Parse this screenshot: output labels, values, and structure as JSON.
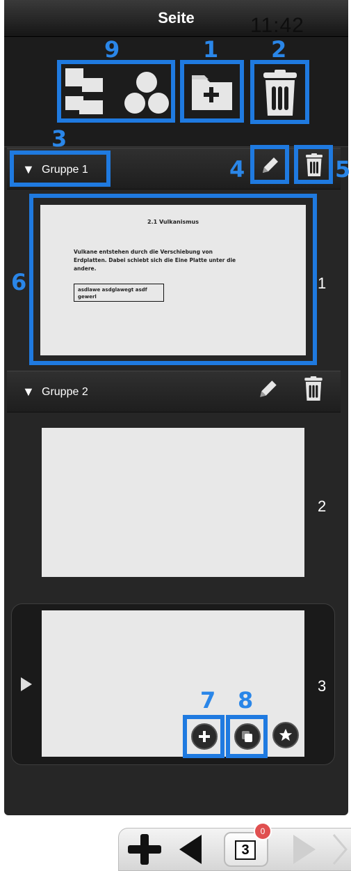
{
  "header": {
    "title": "Seite",
    "clock": "11:42"
  },
  "annotations": {
    "n1": "1",
    "n2": "2",
    "n3": "3",
    "n4": "4",
    "n5": "5",
    "n6": "6",
    "n7": "7",
    "n8": "8",
    "n9": "9"
  },
  "groups": [
    {
      "label": "Gruppe 1",
      "pages": [
        {
          "number": "1",
          "title": "2.1 Vulkanismus",
          "body": "Vulkane entstehen durch die Verschiebung von Erdplatten. Dabei schiebt sich die Eine Platte unter die andere.",
          "box": "asdlawe asdglawegt asdf gewerl"
        }
      ]
    },
    {
      "label": "Gruppe 2",
      "pages": [
        {
          "number": "2"
        },
        {
          "number": "3"
        }
      ]
    }
  ],
  "bottom": {
    "page_counter": "3",
    "badge": "0"
  },
  "colors": {
    "highlight": "#1f7ae0",
    "panel": "#262626",
    "badge": "#e05050"
  },
  "icons": {
    "layout": "layout-icon",
    "shapes": "shapes-icon",
    "new_folder": "folder-plus-icon",
    "trash": "trash-icon",
    "pencil": "pencil-icon",
    "add": "plus-icon",
    "copy": "copy-icon",
    "star": "star-icon"
  }
}
